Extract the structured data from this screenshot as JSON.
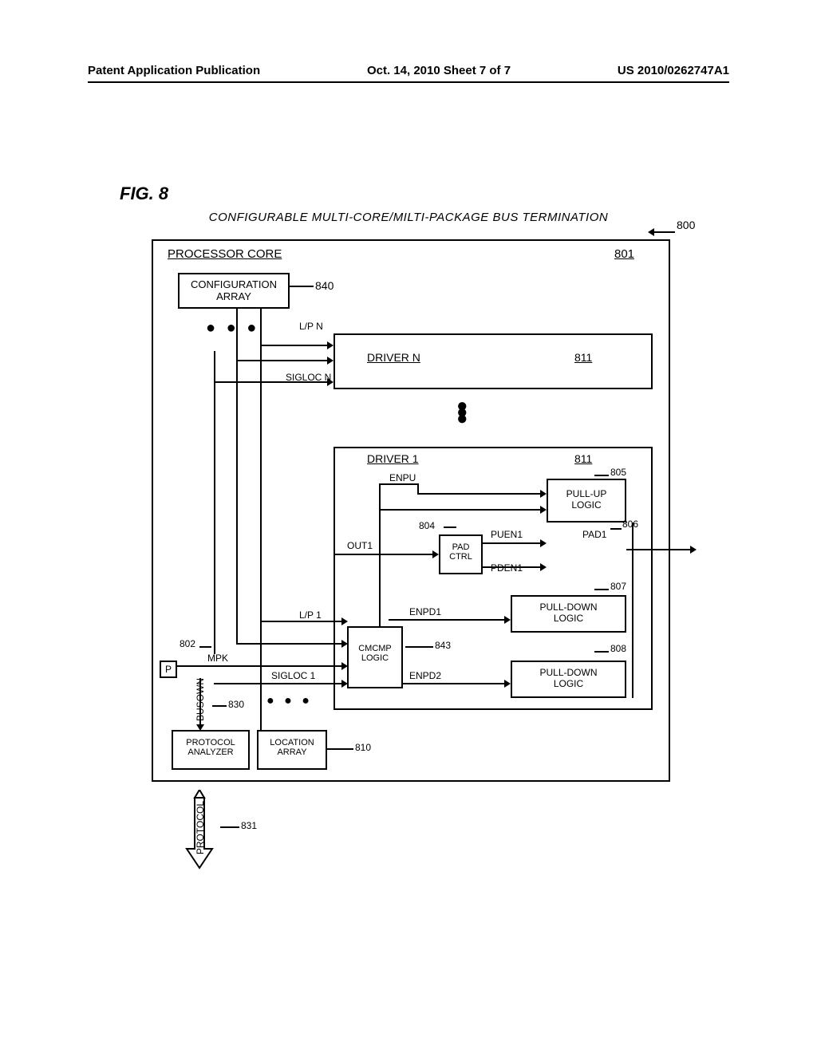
{
  "header": {
    "left": "Patent Application Publication",
    "center": "Oct. 14, 2010  Sheet 7 of 7",
    "right": "US 2010/0262747A1"
  },
  "fig": "FIG. 8",
  "title": "CONFIGURABLE MULTI-CORE/MILTI-PACKAGE BUS TERMINATION",
  "refs": {
    "r800": "800",
    "r801": "801",
    "r840": "840",
    "r811a": "811",
    "r811b": "811",
    "r805": "805",
    "r804": "804",
    "r806": "806",
    "r807": "807",
    "r843": "843",
    "r808": "808",
    "r802": "802",
    "r830": "830",
    "r810": "810",
    "r831": "831"
  },
  "labels": {
    "processor_core": "PROCESSOR CORE",
    "config_array": "CONFIGURATION\nARRAY",
    "lpn": "L/P N",
    "driver_n": "DRIVER N",
    "sigloc_n": "SIGLOC N",
    "driver_1": "DRIVER 1",
    "enpu": "ENPU",
    "pullup": "PULL-UP\nLOGIC",
    "out1": "OUT1",
    "pad_ctrl": "PAD\nCTRL",
    "puen1": "PUEN1",
    "pad1": "PAD1",
    "pden1": "PDEN1",
    "pulldown": "PULL-DOWN\nLOGIC",
    "lp1": "L/P 1",
    "enpd1": "ENPD1",
    "cmcmp": "CMCMP\nLOGIC",
    "mpk": "MPK",
    "sigloc_1": "SIGLOC 1",
    "enpd2": "ENPD2",
    "pulldown2": "PULL-DOWN\nLOGIC",
    "p": "P",
    "busown": "BUSOWN",
    "protocol_analyzer": "PROTOCOL\nANALYZER",
    "location_array": "LOCATION\nARRAY",
    "protocol": "PROTOCOL"
  }
}
